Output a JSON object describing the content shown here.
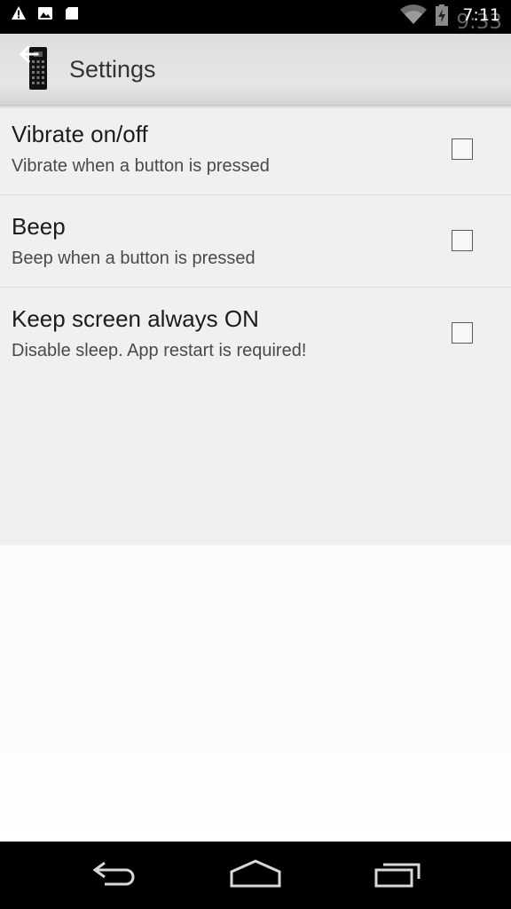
{
  "status_bar": {
    "time": "7:11",
    "time_ghost": "9:33",
    "left_icons": [
      "warning-icon",
      "image-icon",
      "sd-card-icon"
    ],
    "right_icons": [
      "wifi-icon",
      "battery-charging-icon"
    ]
  },
  "action_bar": {
    "title": "Settings",
    "icons": [
      "back-arrow-icon",
      "remote-control-app-icon"
    ]
  },
  "preferences": [
    {
      "title": "Vibrate on/off",
      "summary": "Vibrate when a button is pressed",
      "checked": false
    },
    {
      "title": "Beep",
      "summary": "Beep when a button is pressed",
      "checked": false
    },
    {
      "title": "Keep screen always ON",
      "summary": "Disable sleep. App restart is required!",
      "checked": false
    }
  ],
  "nav_bar": {
    "buttons": [
      "back-icon",
      "home-icon",
      "recents-icon"
    ]
  },
  "colors": {
    "status_bar_bg": "#000000",
    "action_bar_bg": "#e2e2e2",
    "list_bg": "#f1eff0",
    "text_primary": "#1c1c1c",
    "text_secondary": "#4a4a4a"
  }
}
